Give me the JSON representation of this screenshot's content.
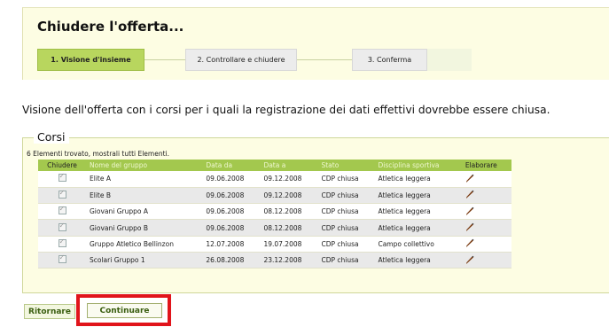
{
  "page": {
    "title": "Chiudere l'offerta..."
  },
  "steps": [
    {
      "label": "1. Visione d'insieme",
      "active": true
    },
    {
      "label": "2. Controllare e chiudere",
      "active": false
    },
    {
      "label": "3. Conferma",
      "active": false
    }
  ],
  "intro_text": "Visione dell'offerta con i corsi per i quali la registrazione dei dati effettivi dovrebbe essere chiusa.",
  "section": {
    "title": "Corsi",
    "count_text": "6 Elementi trovato, mostrali tutti Elementi."
  },
  "table": {
    "headers": [
      "Chiudere",
      "Nome del gruppo",
      "Data da",
      "Data a",
      "Stato",
      "Disciplina sportiva",
      "Elaborare"
    ],
    "rows": [
      {
        "name": "Elite A",
        "from": "09.06.2008",
        "to": "09.12.2008",
        "status": "CDP chiusa",
        "discipline": "Atletica leggera"
      },
      {
        "name": "Elite B",
        "from": "09.06.2008",
        "to": "09.12.2008",
        "status": "CDP chiusa",
        "discipline": "Atletica leggera"
      },
      {
        "name": "Giovani Gruppo A",
        "from": "09.06.2008",
        "to": "08.12.2008",
        "status": "CDP chiusa",
        "discipline": "Atletica leggera"
      },
      {
        "name": "Giovani Gruppo B",
        "from": "09.06.2008",
        "to": "08.12.2008",
        "status": "CDP chiusa",
        "discipline": "Atletica leggera"
      },
      {
        "name": "Gruppo Atletico Bellinzon",
        "from": "12.07.2008",
        "to": "19.07.2008",
        "status": "CDP chiusa",
        "discipline": "Campo collettivo"
      },
      {
        "name": "Scolari Gruppo 1",
        "from": "26.08.2008",
        "to": "23.12.2008",
        "status": "CDP chiusa",
        "discipline": "Atletica leggera"
      }
    ]
  },
  "buttons": {
    "back": "Ritornare",
    "continue": "Continuare"
  },
  "colors": {
    "accent": "#b8d65e",
    "header_row": "#a3c84e",
    "highlight": "#e1141b",
    "panel": "#fdfde3"
  },
  "icons": {
    "checkbox": "checkbox-checked-disabled",
    "edit": "pencil-icon"
  }
}
